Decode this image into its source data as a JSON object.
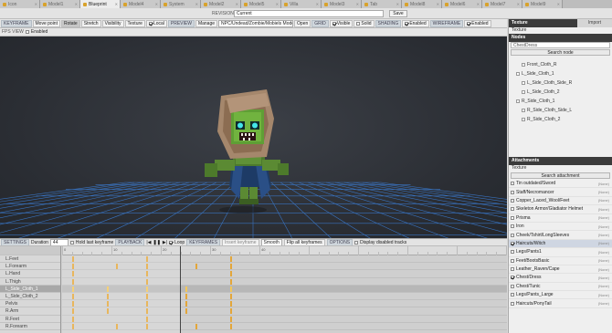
{
  "tabs": [
    {
      "label": "Icon",
      "active": false
    },
    {
      "label": "Model1",
      "active": false
    },
    {
      "label": "Blueprint",
      "active": true
    },
    {
      "label": "Model4",
      "active": false
    },
    {
      "label": "System",
      "active": false
    },
    {
      "label": "Model2",
      "active": false
    },
    {
      "label": "Model5",
      "active": false
    },
    {
      "label": "Villa",
      "active": false
    },
    {
      "label": "Model3",
      "active": false
    },
    {
      "label": "Tab",
      "active": false
    },
    {
      "label": "Model8",
      "active": false
    },
    {
      "label": "Model6",
      "active": false
    },
    {
      "label": "Model7",
      "active": false
    },
    {
      "label": "Model9",
      "active": false
    }
  ],
  "revision": {
    "label": "REVISION",
    "value": "Current",
    "save": "Save"
  },
  "toolbar": {
    "keyframe": "KEYFRAME",
    "move_point": "Move point",
    "rotate": "Rotate",
    "stretch": "Stretch",
    "visibility": "Visibility",
    "texture": "Texture",
    "local": "Local",
    "preview": "PREVIEW",
    "manage": "Manage",
    "model_path": "NPC/Undead/Zombie/Mobiels Model",
    "open": "Open",
    "grid": "GRID",
    "visible": "Visible",
    "solid": "Solid",
    "shading": "SHADING",
    "enabled": "Enabled",
    "wireframe": "WIREFRAME",
    "enabled2": "Enabled"
  },
  "fps": {
    "label": "FPS VIEW",
    "enabled": "Enabled"
  },
  "texture_panel": {
    "title": "Texture",
    "tab": "Texture",
    "import": "Import"
  },
  "nodes_panel": {
    "title": "Nodes",
    "search_value": "ChestDress",
    "search_button": "Search node",
    "items": [
      {
        "label": "Front_Cloth_R",
        "indent": 14,
        "toggle": true
      },
      {
        "label": "L_Side_Cloth_1",
        "indent": 8,
        "toggle": true
      },
      {
        "label": "L_Side_Cloth_Side_R",
        "indent": 14,
        "toggle": true
      },
      {
        "label": "L_Side_Cloth_2",
        "indent": 14,
        "toggle": true
      },
      {
        "label": "R_Side_Cloth_1",
        "indent": 8,
        "toggle": true
      },
      {
        "label": "R_Side_Cloth_Side_L",
        "indent": 14,
        "toggle": true
      },
      {
        "label": "R_Side_Cloth_2",
        "indent": 14,
        "toggle": true
      }
    ]
  },
  "attachments_panel": {
    "title": "Attachments",
    "tab": "Texture",
    "search_button": "Search attachment",
    "items": [
      {
        "label": "Tin outdated/Sword",
        "right": "(None)",
        "checked": false,
        "selected": false
      },
      {
        "label": "Staff/Necromancer",
        "right": "(None)",
        "checked": false,
        "selected": false
      },
      {
        "label": "Copper_Laced_Wool/Feet",
        "right": "(None)",
        "checked": false,
        "selected": false
      },
      {
        "label": "Skeleton Armor/Gladiator Helmet",
        "right": "(None)",
        "checked": false,
        "selected": false
      },
      {
        "label": "Prisma",
        "right": "(None)",
        "checked": false,
        "selected": false
      },
      {
        "label": "Iron",
        "right": "(None)",
        "checked": false,
        "selected": false
      },
      {
        "label": "Cheek/Tshirt/LongSleeves",
        "right": "(None)",
        "checked": false,
        "selected": false
      },
      {
        "label": "Haircuts/Witch",
        "right": "(None)",
        "checked": true,
        "selected": true
      },
      {
        "label": "Legs/Pants1",
        "right": "(None)",
        "checked": false,
        "selected": false
      },
      {
        "label": "Feet/BootsBasic",
        "right": "(None)",
        "checked": false,
        "selected": false
      },
      {
        "label": "Leather_Raven/Cape",
        "right": "(None)",
        "checked": false,
        "selected": false
      },
      {
        "label": "Chest/Dress",
        "right": "(None)",
        "checked": true,
        "selected": false
      },
      {
        "label": "Chest/Tunic",
        "right": "(None)",
        "checked": false,
        "selected": false
      },
      {
        "label": "Legs/Pants_Large",
        "right": "(None)",
        "checked": false,
        "selected": false
      },
      {
        "label": "Haircuts/PonyTail",
        "right": "(None)",
        "checked": false,
        "selected": false
      }
    ]
  },
  "settings": {
    "label": "SETTINGS",
    "duration_label": "Duration",
    "duration_value": "44",
    "hold_last": "Hold last keyframe",
    "playback": "PLAYBACK",
    "loop": "Loop",
    "keyframes": "KEYFRAMES",
    "insert_keyframe": "Insert keyframe",
    "smooth": "Smooth",
    "flip_all": "Flip all keyframes",
    "options": "OPTIONS",
    "display_disabled": "Display disabled tracks"
  },
  "tracks": [
    {
      "label": "",
      "highlight": false,
      "keys": [],
      "first": true
    },
    {
      "label": "L.Feet",
      "highlight": false,
      "keys": [
        2,
        17,
        34
      ]
    },
    {
      "label": "L.Forearm",
      "highlight": false,
      "keys": [
        2,
        11,
        17,
        27,
        34
      ]
    },
    {
      "label": "L.Hand",
      "highlight": false,
      "keys": [
        2,
        17,
        34
      ]
    },
    {
      "label": "L.Thigh",
      "highlight": false,
      "keys": [
        2,
        17,
        34
      ]
    },
    {
      "label": "L_Side_Cloth_1",
      "highlight": true,
      "keys": [
        2,
        9,
        17,
        25,
        34
      ]
    },
    {
      "label": "L_Side_Cloth_2",
      "highlight": false,
      "keys": [
        2,
        9,
        17,
        25,
        34
      ]
    },
    {
      "label": "Pelvis",
      "highlight": false,
      "keys": [
        2,
        9,
        17,
        25,
        34
      ]
    },
    {
      "label": "R.Arm",
      "highlight": false,
      "keys": [
        2,
        9,
        17,
        25,
        34
      ]
    },
    {
      "label": "R.Feet",
      "highlight": false,
      "keys": [
        2,
        17,
        34
      ]
    },
    {
      "label": "R.Forearm",
      "highlight": false,
      "keys": [
        2,
        11,
        17,
        27,
        34
      ]
    }
  ],
  "ruler": {
    "marks": [
      "0",
      "10",
      "20",
      "30",
      "40"
    ]
  },
  "colors": {
    "accent": "#e3a63a",
    "header": "#3b3b3b",
    "viewport": "#2c2f35",
    "grid": "#3b7fd9"
  }
}
